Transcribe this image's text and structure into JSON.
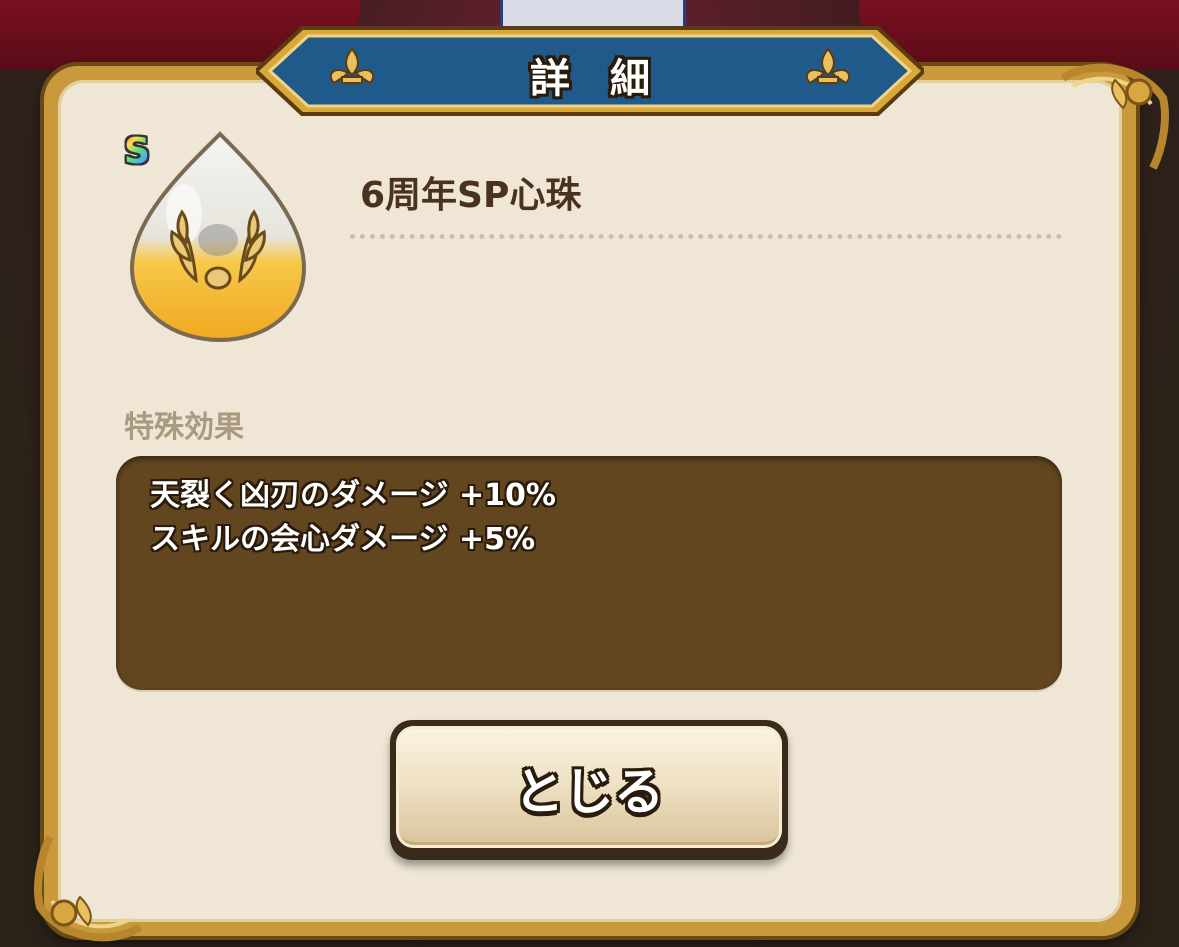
{
  "dialog": {
    "title": "詳細",
    "close_label": "とじる"
  },
  "item": {
    "rank": "S",
    "name": "6周年SP心珠",
    "icon": "laurel-orb-icon"
  },
  "special_effects": {
    "label": "特殊効果",
    "lines": [
      "天裂く凶刃のダメージ +10%",
      "スキルの会心ダメージ +5%"
    ]
  },
  "colors": {
    "frame_gold": "#c89a3c",
    "panel_bg": "#efe6d5",
    "banner_blue": "#1f5a8a",
    "effects_bg": "#624620",
    "title_text": "#4a3220",
    "label_text": "#a99a82"
  }
}
